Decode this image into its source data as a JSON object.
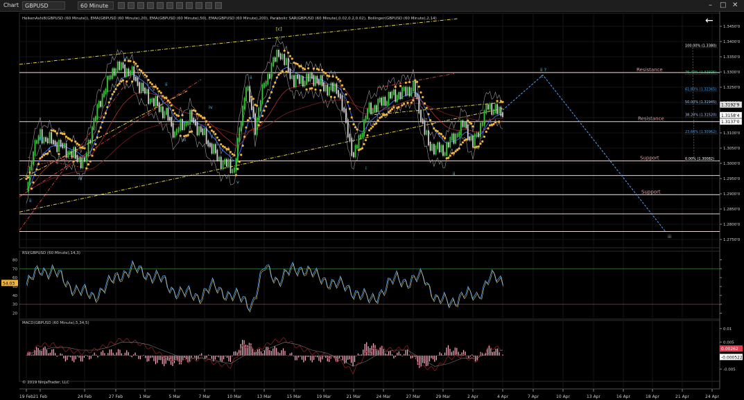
{
  "toolbar": {
    "chart_label": "Chart",
    "instrument": "GBPUSD",
    "timeframe": "60 Minute"
  },
  "chart_data": {
    "type": "line",
    "panels": [
      {
        "name": "price",
        "title": "HeikenAshi8(GBPUSD (60 Minute)), EMA(GBPUSD (60 Minute),20), EMA(GBPUSD (60 Minute),50), EMA(GBPUSD (60 Minute),200), Parabolic SAR(GBPUSD (60 Minute),0.02,0.2,0.02), Bollinger(GBPUSD (60 Minute),2,14)",
        "ylim": [
          1.2725,
          1.3475
        ],
        "yticks": [
          "1.3450'0",
          "1.3400'0",
          "1.3350'0",
          "1.3300'0",
          "1.3250'0",
          "1.3200'0",
          "1.3150'0",
          "1.3100'0",
          "1.3050'0",
          "1.3000'0",
          "1.2950'0",
          "1.2900'0",
          "1.2850'0",
          "1.2800'0",
          "1.2750'0"
        ],
        "price_labels": [
          "1.3192'9",
          "1.3158'4",
          "1.3137'0"
        ],
        "horizontal_lines": [
          {
            "label": "Resistance",
            "y": 1.3298
          },
          {
            "label": "Resistance",
            "y": 1.3137
          },
          {
            "label": "Support",
            "y": 1.3008
          },
          {
            "label": "Support",
            "y": 1.2897
          },
          {
            "label": "",
            "y": 1.296
          },
          {
            "label": "",
            "y": 1.2834
          },
          {
            "label": "",
            "y": 1.2776
          }
        ],
        "fibonacci": [
          {
            "label": "100.00% (1.3380)",
            "y": 1.338
          },
          {
            "label": "76.40% (1.32925)",
            "y": 1.32925
          },
          {
            "label": "61.80% (1.32365)",
            "y": 1.32365
          },
          {
            "label": "50.00% (1.31945)",
            "y": 1.31945
          },
          {
            "label": "38.20% (1.31520)",
            "y": 1.3152
          },
          {
            "label": "23.60% (1.30962)",
            "y": 1.30962
          },
          {
            "label": "0.00% (1.30082)",
            "y": 1.30082
          }
        ],
        "wave_labels": [
          "ii",
          "iii",
          "iv",
          "v",
          "i",
          "ii",
          "iii",
          "iv",
          "v",
          "?",
          "[c]",
          "(c)",
          "c",
          "ii",
          "i",
          "ii",
          "ii ?",
          "c",
          "iii"
        ],
        "projection": [
          {
            "x": "4 Apr",
            "y": 1.3175
          },
          {
            "x": "8 Apr",
            "y": 1.329
          },
          {
            "x": "20 Apr",
            "y": 1.2775
          }
        ],
        "price_path": [
          {
            "x": "19 Feb",
            "y": 1.29
          },
          {
            "x": "20 Feb",
            "y": 1.305
          },
          {
            "x": "21 Feb",
            "y": 1.309
          },
          {
            "x": "22 Feb",
            "y": 1.306
          },
          {
            "x": "24 Feb",
            "y": 1.3
          },
          {
            "x": "25 Feb",
            "y": 1.312
          },
          {
            "x": "26 Feb",
            "y": 1.324
          },
          {
            "x": "27 Feb",
            "y": 1.332
          },
          {
            "x": "28 Feb",
            "y": 1.33
          },
          {
            "x": "1 Mar",
            "y": 1.323
          },
          {
            "x": "4 Mar",
            "y": 1.316
          },
          {
            "x": "5 Mar",
            "y": 1.31
          },
          {
            "x": "6 Mar",
            "y": 1.315
          },
          {
            "x": "7 Mar",
            "y": 1.309
          },
          {
            "x": "8 Mar",
            "y": 1.301
          },
          {
            "x": "10 Mar",
            "y": 1.298
          },
          {
            "x": "11 Mar",
            "y": 1.326
          },
          {
            "x": "12 Mar",
            "y": 1.312
          },
          {
            "x": "13 Mar",
            "y": 1.326
          },
          {
            "x": "14 Mar",
            "y": 1.337
          },
          {
            "x": "15 Mar",
            "y": 1.327
          },
          {
            "x": "18 Mar",
            "y": 1.328
          },
          {
            "x": "19 Mar",
            "y": 1.325
          },
          {
            "x": "20 Mar",
            "y": 1.324
          },
          {
            "x": "21 Mar",
            "y": 1.302
          },
          {
            "x": "22 Mar",
            "y": 1.317
          },
          {
            "x": "25 Mar",
            "y": 1.322
          },
          {
            "x": "26 Mar",
            "y": 1.323
          },
          {
            "x": "27 Mar",
            "y": 1.325
          },
          {
            "x": "28 Mar",
            "y": 1.306
          },
          {
            "x": "29 Mar",
            "y": 1.304
          },
          {
            "x": "1 Apr",
            "y": 1.313
          },
          {
            "x": "2 Apr",
            "y": 1.306
          },
          {
            "x": "3 Apr",
            "y": 1.319
          },
          {
            "x": "4 Apr",
            "y": 1.3158
          }
        ]
      },
      {
        "name": "rsi",
        "title": "RSI(GBPUSD (60 Minute),14,3)",
        "ylim": [
          15,
          85
        ],
        "yticks": [
          "80",
          "70",
          "60",
          "50",
          "40",
          "30",
          "20"
        ],
        "levels": [
          70,
          30
        ],
        "current": "54.03",
        "values": [
          52,
          70,
          68,
          55,
          45,
          40,
          50,
          64,
          70,
          66,
          60,
          48,
          42,
          40,
          50,
          44,
          38,
          30,
          72,
          58,
          68,
          72,
          60,
          56,
          50,
          44,
          34,
          48,
          60,
          56,
          62,
          36,
          32,
          42,
          38,
          62,
          54
        ]
      },
      {
        "name": "macd",
        "title": "MACD(GBPUSD (60 Minute),5,34,5)",
        "ylim": [
          -0.008,
          0.012
        ],
        "yticks": [
          "0.01",
          "0.005",
          "0",
          "-0.005"
        ],
        "labels": [
          "0.00262",
          "-0.000522"
        ],
        "macd": [
          0,
          0.004,
          0.004,
          0.002,
          0.001,
          0.002,
          0.004,
          0.006,
          0.005,
          0.003,
          0.0,
          -0.002,
          -0.002,
          -0.001,
          -0.003,
          -0.004,
          0.004,
          0.002,
          0.005,
          0.006,
          0.003,
          0.001,
          0.0,
          -0.002,
          -0.006,
          0.001,
          0.003,
          0.002,
          0.003,
          -0.004,
          -0.005,
          -0.001,
          0.0,
          -0.002,
          0.003,
          0.00262
        ],
        "signal": [
          0,
          0.002,
          0.003,
          0.003,
          0.002,
          0.002,
          0.003,
          0.005,
          0.005,
          0.004,
          0.002,
          0.0,
          -0.001,
          -0.001,
          -0.002,
          -0.003,
          0.0,
          0.001,
          0.003,
          0.005,
          0.004,
          0.002,
          0.001,
          -0.001,
          -0.004,
          -0.002,
          0.001,
          0.002,
          0.002,
          -0.001,
          -0.004,
          -0.003,
          -0.001,
          -0.001,
          0.001,
          0.002
        ]
      }
    ],
    "x_tick_labels": [
      "19 Feb",
      "21 Feb",
      "24 Feb",
      "27 Feb",
      "1 Mar",
      "5 Mar",
      "7 Mar",
      "10 Mar",
      "13 Mar",
      "15 Mar",
      "19 Mar",
      "21 Mar",
      "24 Mar",
      "27 Mar",
      "29 Mar",
      "2 Apr",
      "4 Apr",
      "7 Apr",
      "10 Apr",
      "13 Apr",
      "16 Apr",
      "18 Apr",
      "21 Apr",
      "24 Apr"
    ],
    "copyright": "© 2019 NinjaTrader, LLC"
  },
  "colors": {
    "background": "#000000",
    "heiken_up": "#37c837",
    "heiken_down": "#c8c8c8",
    "sar": "#f0b43c",
    "ema20": "#3c78ff",
    "channel_yellow": "#e6d23c",
    "channel_red": "#d23c3c",
    "projection": "#5aa0ff",
    "horizontal": "#f0e6e6",
    "rsi_line": "#4ea8ff",
    "macd_hist": "#ffb4c8",
    "macd_line": "#8c1e1e"
  }
}
